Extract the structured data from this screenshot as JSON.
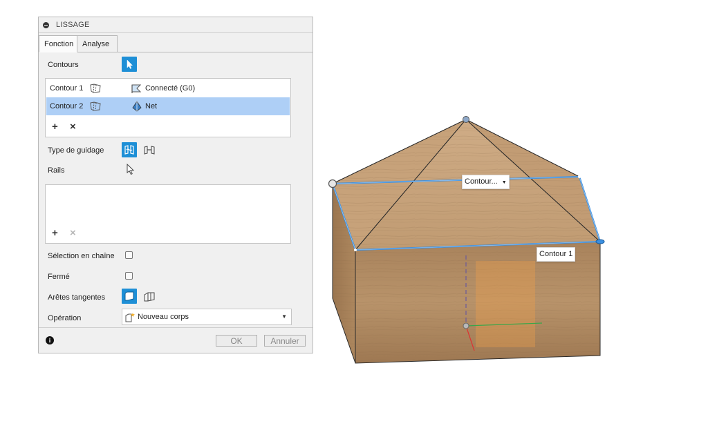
{
  "panel": {
    "title": "LISSAGE",
    "tabs": [
      {
        "label": "Fonction",
        "active": true
      },
      {
        "label": "Analyse",
        "active": false
      }
    ],
    "contours_label": "Contours",
    "contours": [
      {
        "name": "Contour 1",
        "continuity": "Connecté (G0)",
        "selected": false
      },
      {
        "name": "Contour 2",
        "continuity": "Net",
        "selected": true
      }
    ],
    "guide_type_label": "Type de guidage",
    "rails_label": "Rails",
    "chain_selection_label": "Sélection en chaîne",
    "chain_selection_checked": false,
    "closed_label": "Fermé",
    "closed_checked": false,
    "tangent_edges_label": "Arêtes tangentes",
    "operation_label": "Opération",
    "operation_value": "Nouveau corps",
    "ok_label": "OK",
    "cancel_label": "Annuler"
  },
  "viewport": {
    "tooltip_top": "Contour...",
    "tooltip_edge": "Contour 1"
  },
  "colors": {
    "accent": "#1e8fd6",
    "selected_row": "#aecff6",
    "wood_light": "#c9a57e",
    "wood_dark": "#9c7650",
    "profile_line": "#3b8fe0"
  }
}
